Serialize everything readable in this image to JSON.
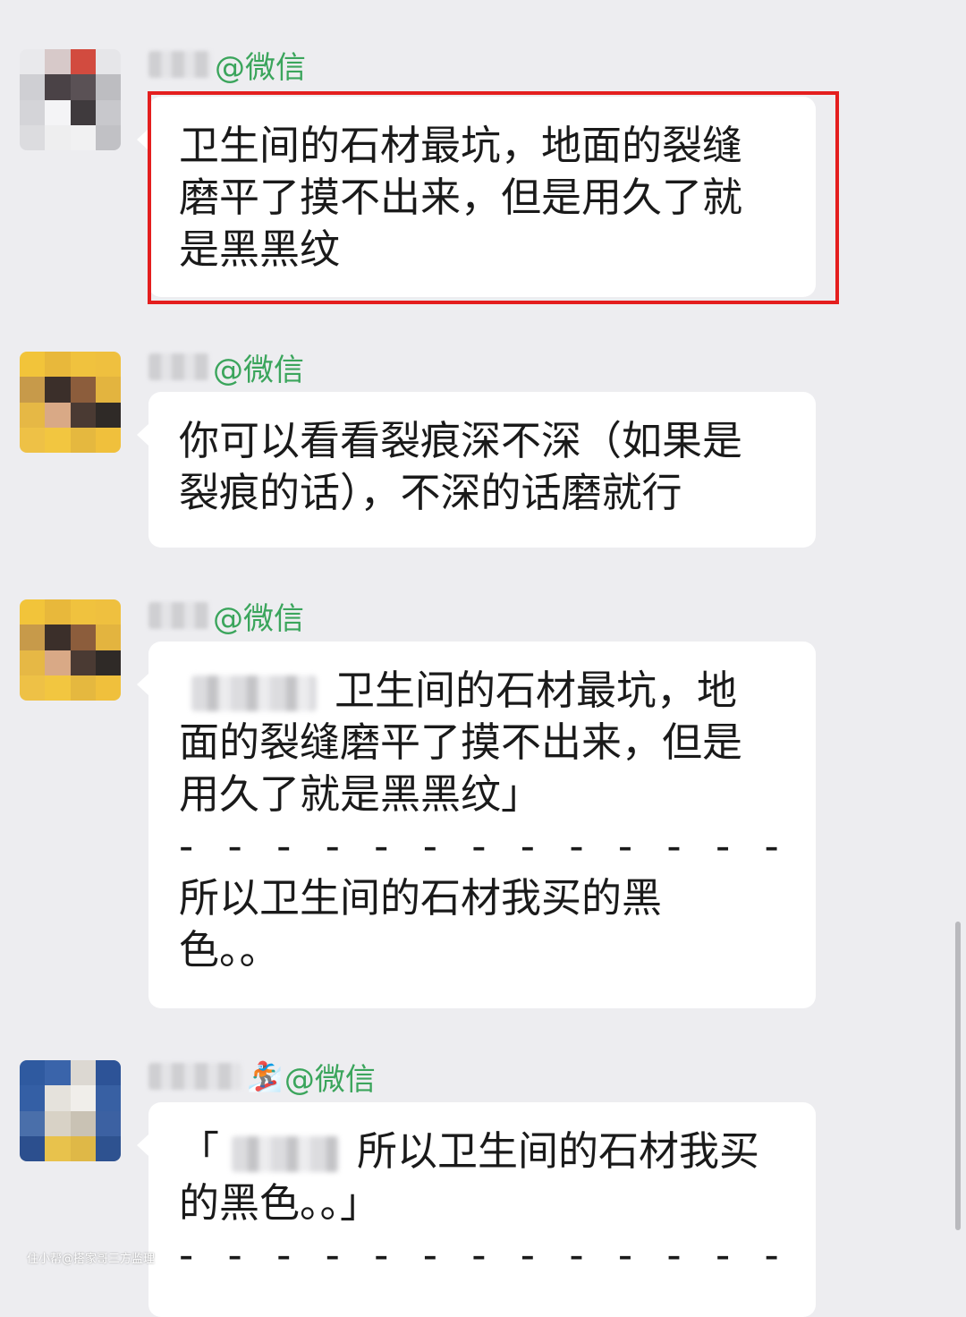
{
  "messages": [
    {
      "sender_suffix": "@微信",
      "lines": [
        "卫生间的石材最坑，地面的裂缝",
        "磨平了摸不出来，但是用久了就",
        "是黑黑纹"
      ]
    },
    {
      "sender_suffix": "@微信",
      "lines": [
        "你可以看看裂痕深不深（如果是",
        "裂痕的话），不深的话磨就行"
      ]
    },
    {
      "sender_suffix": "@微信",
      "quote_line1_tail": "卫生间的石材最坑，地",
      "lines": [
        "面的裂缝磨平了摸不出来，但是",
        "用久了就是黑黑纹」"
      ],
      "separator": "- - - - - - - - - - - - - - - -",
      "reply_lines": [
        "所以卫生间的石材我买的黑",
        "色。。"
      ]
    },
    {
      "sender_suffix": "@微信",
      "sender_emoji": "🏂",
      "quote_open": "「",
      "quote_line1_tail": "所以卫生间的石材我买",
      "lines": [
        "的黑色。。」"
      ],
      "separator": "- - - - - - - - - - - - - - - -"
    }
  ],
  "watermark": "住小帮@搭家哥三方监理",
  "colors": {
    "accent_green": "#3ba55c",
    "highlight_red": "#e41e1e",
    "background": "#ededf0"
  },
  "icons": [
    "snowboarder-emoji"
  ]
}
